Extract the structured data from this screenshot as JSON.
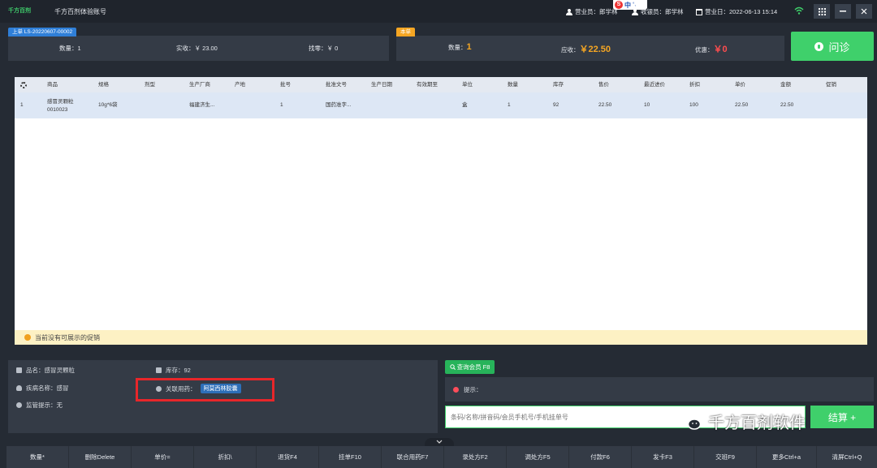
{
  "topbar": {
    "logo_text": "千方百剂",
    "title": "千方百剂体验账号",
    "salesperson": "营业员：郎学林",
    "cashier": "收银员：郎学林",
    "business_day": "营业日：2022-06-13 15:14",
    "ime_indicator": "中",
    "ime_dot": "°,"
  },
  "last_order": {
    "tag": "上单 LS-20220607-00002",
    "qty": "数量：1",
    "received": "实收：￥ 23.00",
    "change": "找零：￥ 0"
  },
  "current_order": {
    "tag": "本单",
    "qty_label": "数量：",
    "qty_value": "1",
    "due_label": "应收：",
    "due_value": "￥22.50",
    "discount_label": "优惠：",
    "discount_value": "￥0"
  },
  "consult_button": "问诊",
  "table": {
    "columns": [
      "商品",
      "规格",
      "剂型",
      "生产厂商",
      "产地",
      "批号",
      "批准文号",
      "生产日期",
      "有效期至",
      "单位",
      "数量",
      "库存",
      "售价",
      "最近进价",
      "折扣",
      "单价",
      "金额",
      "促销"
    ],
    "row": {
      "index": "1",
      "product_name": "感冒灵颗粒",
      "product_code": "0010023",
      "spec": "10g*6袋",
      "form": "",
      "manufacturer": "福建济生...",
      "origin": "",
      "batch": "1",
      "approval": "国药准字...",
      "mfg_date": "",
      "expiry": "",
      "unit": "盒",
      "qty": "1",
      "stock": "92",
      "price": "22.50",
      "last_cost": "10",
      "discount": "100",
      "unit_price": "22.50",
      "amount": "22.50",
      "promo": ""
    },
    "promo_notice": "当前没有可展示的促销"
  },
  "product_info": {
    "name": "品名：感冒灵颗粒",
    "stock": "库存：92",
    "disease": "疾病名称：感冒",
    "linked_label": "关联用药：",
    "linked_value": "阿莫西林胶囊",
    "supervision": "监管提示：无"
  },
  "member": {
    "query_button": "查询会员 F8",
    "hint_label": "提示：",
    "search_placeholder": "条码/名称/拼音码/会员手机号/手机挂单号",
    "settle_button": "结算 +"
  },
  "watermark": "千方百剂软件",
  "fkeys": [
    "数量*",
    "删除Delete",
    "单价=",
    "折扣\\",
    "退货F4",
    "挂单F10",
    "联合用药F7",
    "录处方F2",
    "调处方F5",
    "付款F6",
    "发卡F3",
    "交班F9",
    "更多Ctrl+a",
    "清屏Ctrl+Q"
  ]
}
